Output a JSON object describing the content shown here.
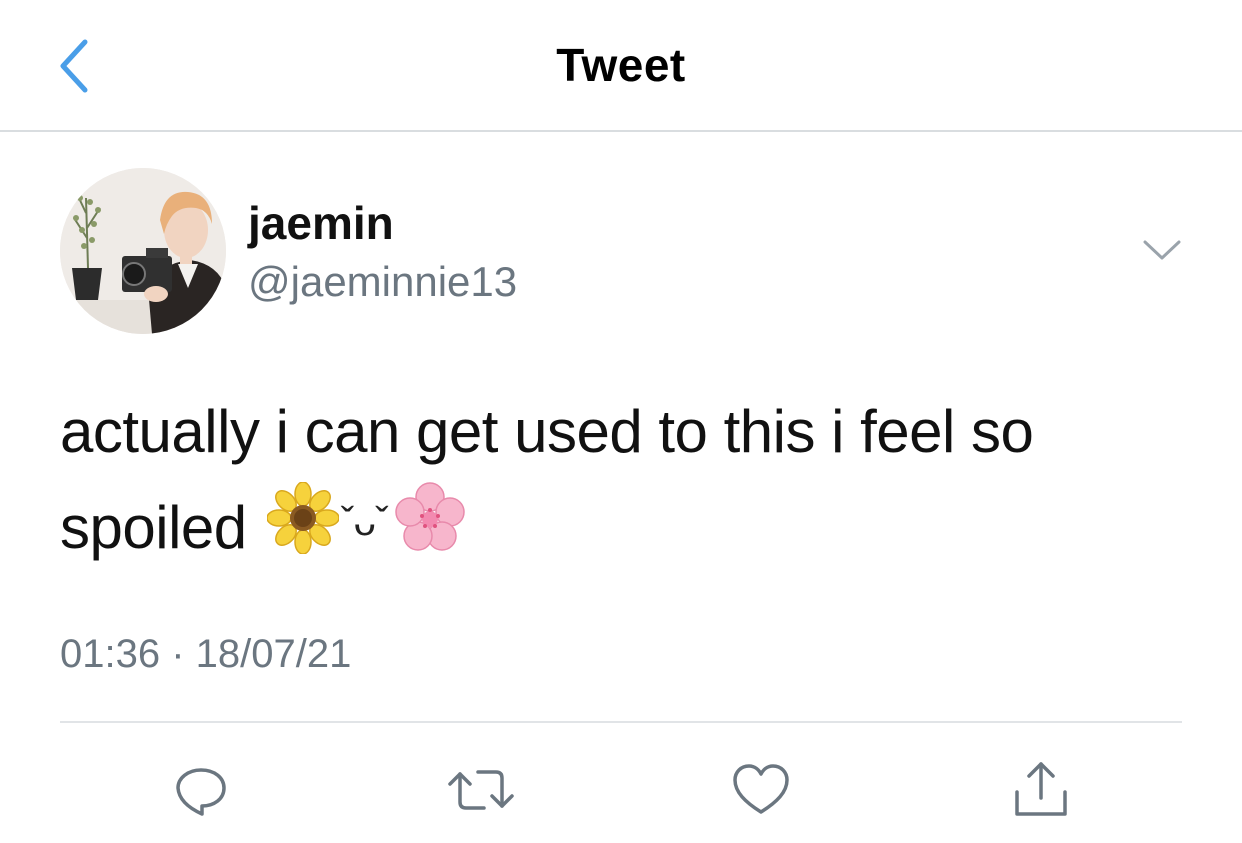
{
  "header": {
    "title": "Tweet",
    "back_icon": "chevron-left-icon"
  },
  "author": {
    "display_name": "jaemin",
    "handle": "@jaeminnie13"
  },
  "tweet": {
    "text_line1": "actually i can get used to this i feel so",
    "text_line2": "spoiled",
    "kaomoji": "ˇᴗˇ",
    "emojis": [
      "sunflower-emoji",
      "cherry-blossom-emoji"
    ],
    "timestamp": "01:36 · 18/07/21"
  },
  "actions": [
    "reply-icon",
    "retweet-icon",
    "like-icon",
    "share-icon"
  ],
  "colors": {
    "accent": "#4a9ee8",
    "text_primary": "#111111",
    "text_secondary": "#6b7680",
    "icon": "#6b7680",
    "divider": "#e1e4e7"
  }
}
